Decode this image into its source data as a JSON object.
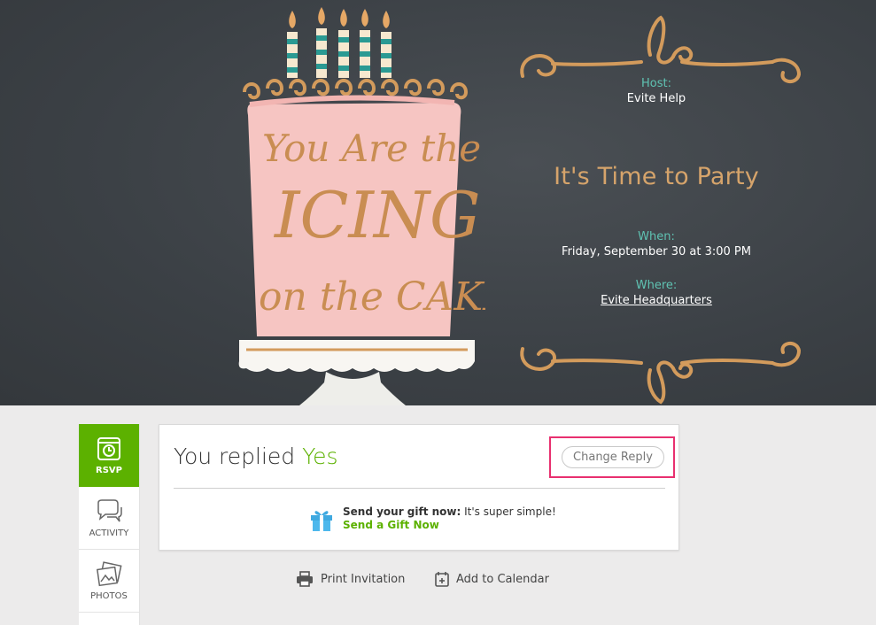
{
  "invitation": {
    "host_label": "Host:",
    "host_name": "Evite Help",
    "event_title": "It's Time to Party",
    "when_label": "When:",
    "when_value": "Friday, September 30 at 3:00 PM",
    "where_label": "Where:",
    "where_value": "Evite Headquarters",
    "cake_text_lines": [
      "You Are the",
      "ICING",
      "on the CAKE"
    ]
  },
  "sidebar": {
    "items": [
      {
        "label": "RSVP",
        "icon": "clock-icon",
        "active": true
      },
      {
        "label": "ACTIVITY",
        "icon": "chat-bubbles-icon",
        "active": false
      },
      {
        "label": "PHOTOS",
        "icon": "photos-icon",
        "active": false
      }
    ]
  },
  "reply": {
    "prefix": "You replied",
    "answer": "Yes",
    "change_button": "Change Reply"
  },
  "gift": {
    "bold": "Send your gift now:",
    "rest": " It's super simple!",
    "link": "Send a Gift Now"
  },
  "actions": {
    "print": "Print Invitation",
    "calendar": "Add to Calendar"
  },
  "colors": {
    "accent_green": "#5cb100",
    "teal_label": "#5fc3b3",
    "gold": "#d6a46b",
    "highlight": "#e8306f",
    "chalkboard": "#3b4045"
  }
}
